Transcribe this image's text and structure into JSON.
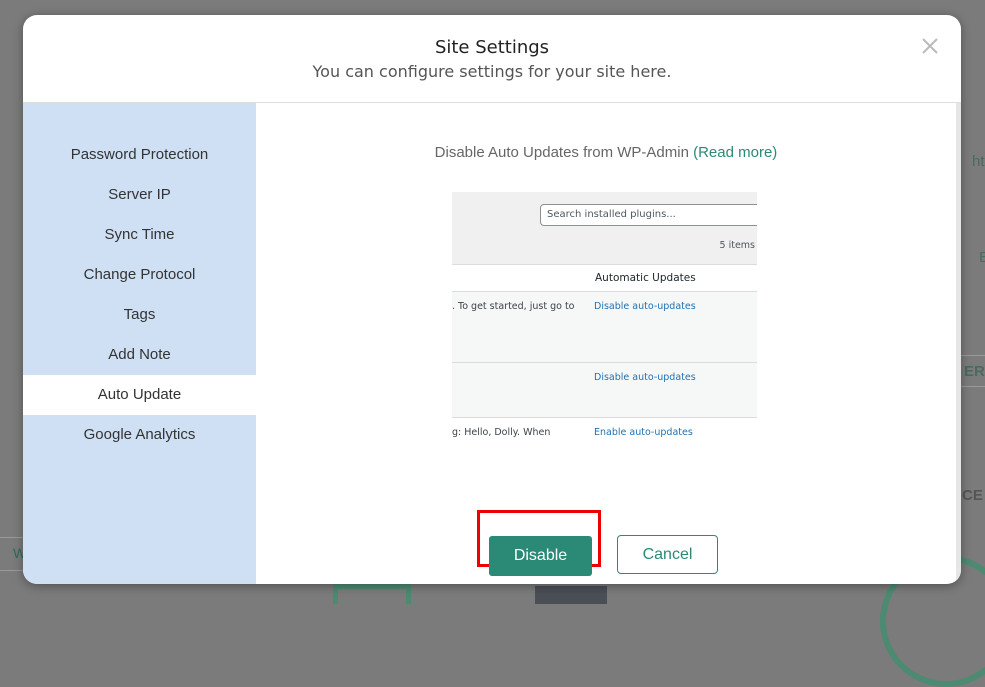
{
  "modal": {
    "title": "Site Settings",
    "subtitle": "You can configure settings for your site here.",
    "close_icon": "close-icon"
  },
  "sidebar": {
    "items": [
      {
        "label": "Password Protection",
        "active": false
      },
      {
        "label": "Server IP",
        "active": false
      },
      {
        "label": "Sync Time",
        "active": false
      },
      {
        "label": "Change Protocol",
        "active": false
      },
      {
        "label": "Tags",
        "active": false
      },
      {
        "label": "Add Note",
        "active": false
      },
      {
        "label": "Auto Update",
        "active": true
      },
      {
        "label": "Google Analytics",
        "active": false
      }
    ]
  },
  "content": {
    "heading_text": "Disable Auto Updates from WP-Admin ",
    "read_more": "(Read more)",
    "screenshot": {
      "search_placeholder": "Search installed plugins...",
      "items_count": "5 items",
      "column_header": "Automatic Updates",
      "rows": [
        {
          "description": ". To get started, just go to",
          "action": "Disable auto-updates"
        },
        {
          "description": "",
          "action": "Disable auto-updates"
        },
        {
          "description": "g: Hello, Dolly. When",
          "action": "Enable auto-updates"
        }
      ]
    },
    "buttons": {
      "disable": "Disable",
      "cancel": "Cancel"
    }
  },
  "background": {
    "fragments": [
      "ht",
      "E",
      "ERC",
      "CE",
      "W"
    ]
  },
  "colors": {
    "accent": "#2a8a76",
    "sidebar_bg": "#cfe0f5",
    "highlight": "#ee0000",
    "wp_link": "#2271b1"
  }
}
